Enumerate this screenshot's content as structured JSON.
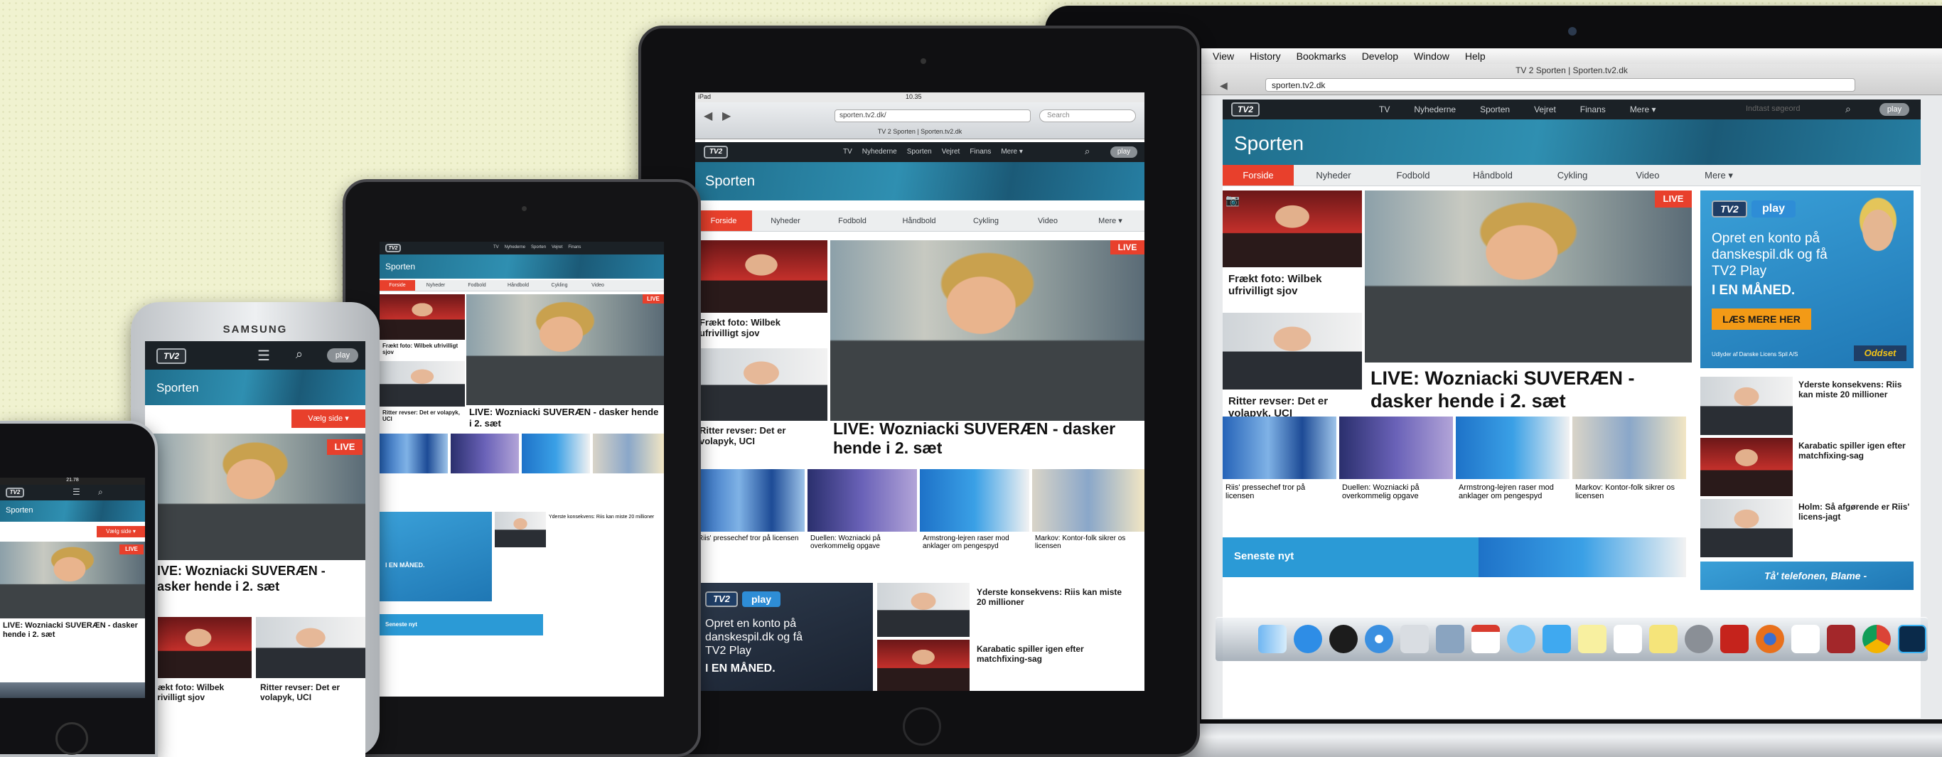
{
  "brand": {
    "logo": "TV2",
    "accent": "#e8402c",
    "banner_blue": "#2a87ab",
    "header_dark": "#1b2126"
  },
  "mac": {
    "menubar": [
      "View",
      "History",
      "Bookmarks",
      "Develop",
      "Window",
      "Help"
    ],
    "window_title": "TV 2 Sporten | Sporten.tv2.dk",
    "url": "sporten.tv2.dk"
  },
  "site": {
    "top_nav": [
      "TV",
      "Nyhederne",
      "Sporten",
      "Vejret",
      "Finans",
      "Mere ▾"
    ],
    "search_placeholder": "Indtast søgeord",
    "play_label": "play",
    "section_title": "Sporten",
    "tabs": [
      "Forside",
      "Nyheder",
      "Fodbold",
      "Håndbold",
      "Cykling",
      "Video",
      "Mere ▾"
    ],
    "live_badge": "LIVE",
    "lead_headline": "LIVE: Wozniacki SUVERÆN - dasker hende i 2. sæt",
    "side_stories": [
      "Frækt foto: Wilbek ufrivilligt sjov",
      "Ritter revser: Det er volapyk, UCI"
    ],
    "strip": [
      "Riis' pressechef tror på licensen",
      "Duellen: Wozniacki på overkommelig opgave",
      "Armstrong-lejren raser mod anklager om pengespyd",
      "Markov: Kontor-folk sikrer os licensen"
    ],
    "right_list": [
      "Yderste konsekvens: Riis kan miste 20 millioner",
      "Karabatic spiller igen efter matchfixing-sag",
      "Holm: Så afgørende er Riis' licens-jagt"
    ],
    "latest_label": "Seneste nyt",
    "phone_cta": "Tå' telefonen, Blame -",
    "ad": {
      "title": "play",
      "text": "Opret en konto på danskespil.dk og få TV2 Play",
      "emph": "I EN MÅNED.",
      "button": "LÆS MERE HER",
      "sponsor": "Oddset",
      "fine": "Udlyder af Danske Licens Spil A/S"
    }
  },
  "ipad": {
    "carrier": "iPad",
    "time": "10.35",
    "url": "sporten.tv2.dk/",
    "search_placeholder": "Search",
    "title": "TV 2 Sporten | Sporten.tv2.dk"
  },
  "samsung": {
    "brand": "SAMSUNG",
    "menu_label": "Vælg side ▾"
  },
  "iphone": {
    "time": "21.78",
    "section": "Sporten",
    "menu_label": "Vælg side ▾"
  }
}
